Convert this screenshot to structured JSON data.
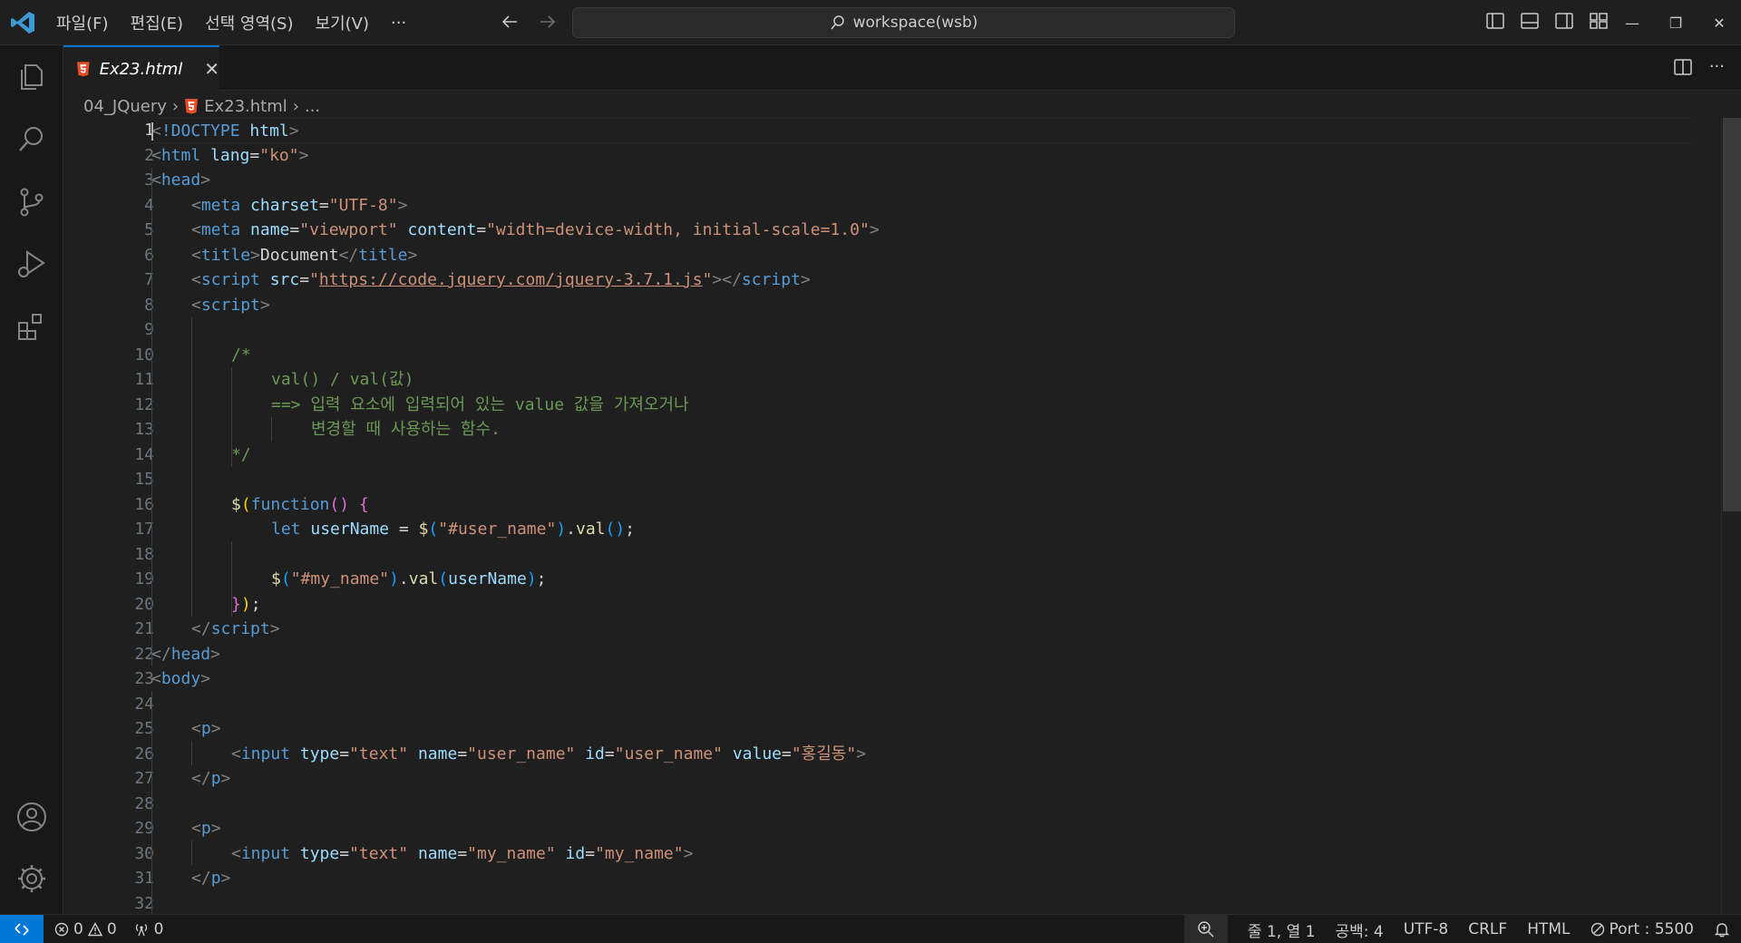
{
  "menu": {
    "items": [
      "파일(F)",
      "편집(E)",
      "선택 영역(S)",
      "보기(V)",
      "···"
    ]
  },
  "command_center": {
    "text": "workspace(wsb)"
  },
  "tabs": [
    {
      "label": "Ex23.html",
      "close": "✕"
    }
  ],
  "breadcrumb": {
    "folder": "04_JQuery",
    "file": "Ex23.html",
    "more": "..."
  },
  "line_numbers": [
    "1",
    "2",
    "3",
    "4",
    "5",
    "6",
    "7",
    "8",
    "9",
    "10",
    "11",
    "12",
    "13",
    "14",
    "15",
    "16",
    "17",
    "18",
    "19",
    "20",
    "21",
    "22",
    "23",
    "24",
    "25",
    "26",
    "27",
    "28",
    "29",
    "30",
    "31",
    "32"
  ],
  "code": {
    "l1_lt": "<",
    "l1_doctype": "!DOCTYPE",
    "l1_html": "html",
    "l1_gt": ">",
    "l2_tag": "html",
    "l2_attr": "lang",
    "l2_val": "\"ko\"",
    "l3_tag": "head",
    "l4_tag": "meta",
    "l4_attr": "charset",
    "l4_val": "\"UTF-8\"",
    "l5_tag": "meta",
    "l5_attr1": "name",
    "l5_val1": "\"viewport\"",
    "l5_attr2": "content",
    "l5_val2": "\"width=device-width, initial-scale=1.0\"",
    "l6_tag": "title",
    "l6_text": "Document",
    "l7_tag": "script",
    "l7_attr": "src",
    "l7_q": "\"",
    "l7_url": "https://code.jquery.com/jquery-3.7.1.js",
    "l8_tag": "script",
    "l10": "/*",
    "l11": "val() / val(값)",
    "l12": "==> 입력 요소에 입력되어 있는 value 값을 가져오거나",
    "l13": "변경할 때 사용하는 함수.",
    "l14": "*/",
    "l16_fn": "$",
    "l16_kw": "function",
    "l17_kw": "let",
    "l17_var": "userName",
    "l17_fn": "$",
    "l17_str": "\"#user_name\"",
    "l17_method": "val",
    "l19_fn": "$",
    "l19_str": "\"#my_name\"",
    "l19_method": "val",
    "l19_var": "userName",
    "l21_tag": "script",
    "l22_tag": "head",
    "l23_tag": "body",
    "l25_tag": "p",
    "l26_tag": "input",
    "l26_a1": "type",
    "l26_v1": "\"text\"",
    "l26_a2": "name",
    "l26_v2": "\"user_name\"",
    "l26_a3": "id",
    "l26_v3": "\"user_name\"",
    "l26_a4": "value",
    "l26_v4": "\"홍길동\"",
    "l27_tag": "p",
    "l29_tag": "p",
    "l30_tag": "input",
    "l30_a1": "type",
    "l30_v1": "\"text\"",
    "l30_a2": "name",
    "l30_v2": "\"my_name\"",
    "l30_a3": "id",
    "l30_v3": "\"my_name\"",
    "l31_tag": "p"
  },
  "status": {
    "errors": "0",
    "warnings": "0",
    "ports_forwarded": "0",
    "position": "줄 1, 열 1",
    "spaces": "공백: 4",
    "encoding": "UTF-8",
    "eol": "CRLF",
    "language": "HTML",
    "port": "Port : 5500"
  },
  "colors": {
    "accent": "#0078d4",
    "html_icon": "#e44d26"
  }
}
